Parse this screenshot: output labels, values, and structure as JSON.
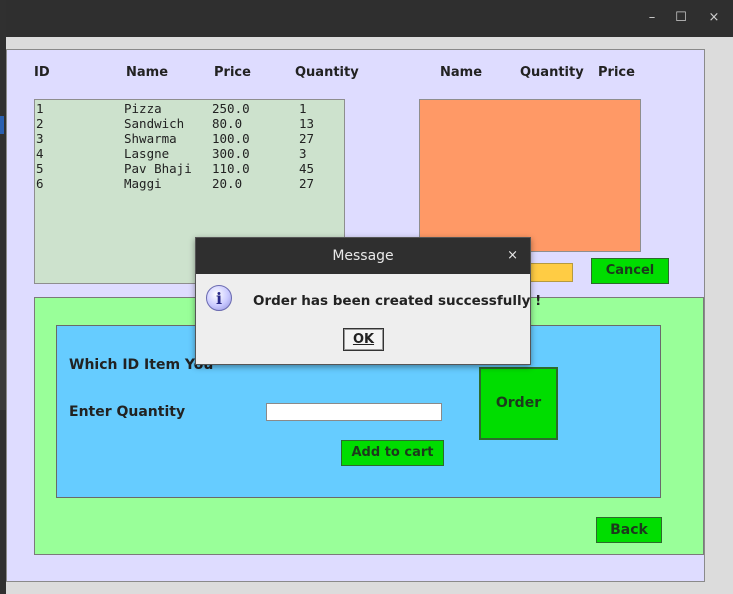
{
  "window": {
    "minimize_glyph": "–",
    "maximize_glyph": "☐",
    "close_glyph": "×"
  },
  "menu": {
    "headers": [
      "ID",
      "Name",
      "Price",
      "Quantity"
    ],
    "rows": [
      [
        "1",
        "Pizza",
        "250.0",
        "1"
      ],
      [
        "2",
        "Sandwich",
        "80.0",
        "13"
      ],
      [
        "3",
        "Shwarma",
        "100.0",
        "27"
      ],
      [
        "4",
        "Lasgne",
        "300.0",
        "3"
      ],
      [
        "5",
        "Pav Bhaji",
        "110.0",
        "45"
      ],
      [
        "6",
        "Maggi",
        "20.0",
        "27"
      ]
    ]
  },
  "cart": {
    "headers": [
      "Name",
      "Quantity",
      "Price"
    ]
  },
  "buttons": {
    "cancel": "Cancel",
    "order": "Order",
    "add_to_cart": "Add to cart",
    "back": "Back"
  },
  "form": {
    "which_id_label": "Which ID Item You",
    "enter_quantity_label": "Enter  Quantity",
    "quantity_value": ""
  },
  "dialog": {
    "title": "Message",
    "close_glyph": "×",
    "icon_glyph": "i",
    "message": "Order has been created successfully !",
    "ok_label": "OK"
  },
  "colors": {
    "frame_bg": "#dedcff",
    "menu_bg": "#cde2cd",
    "cart_bg": "#ff9966",
    "green_panel": "#99ff99",
    "blue_panel": "#66ccff",
    "button_green": "#00dd00",
    "total_field": "#ffcc44"
  }
}
